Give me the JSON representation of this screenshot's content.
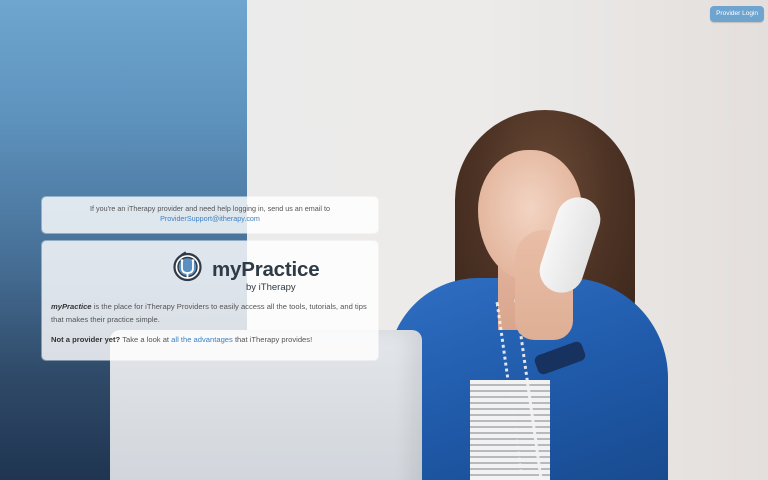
{
  "header": {
    "login_button": "Provider Login"
  },
  "help": {
    "text": "If you're an iTherapy provider and need help logging in, send us an email to",
    "email": "ProviderSupport@itherapy.com"
  },
  "brand": {
    "title": "myPractice",
    "subtitle": "by iTherapy",
    "logo_icon": "stethoscope-icon"
  },
  "intro": {
    "brand_name": "myPractice",
    "description": "is the place for iTherapy Providers to easily access all the tools, tutorials, and tips that makes their practice simple."
  },
  "cta": {
    "lead": "Not a provider yet?",
    "before": "Take a look at",
    "link": "all the advantages",
    "after": "that iTherapy provides!"
  },
  "colors": {
    "accent": "#3b82c4",
    "login_button_bg": "#6fa4cf",
    "left_gradient_top": "#6ea6cf",
    "left_gradient_bottom": "#1f3552"
  }
}
